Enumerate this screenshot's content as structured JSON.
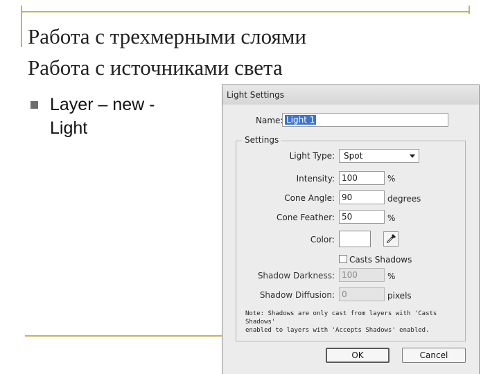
{
  "slide": {
    "title_line1": "Работа с трехмерными слоями",
    "title_line2": "Работа с источниками света",
    "bullet_line1": "Layer – new -",
    "bullet_line2": "Light"
  },
  "dialog": {
    "title": "Light Settings",
    "name_label": "Name:",
    "name_value": "Light 1",
    "settings_group": "Settings",
    "light_type_label": "Light Type:",
    "light_type_value": "Spot",
    "intensity_label": "Intensity:",
    "intensity_value": "100",
    "intensity_unit": "%",
    "cone_angle_label": "Cone Angle:",
    "cone_angle_value": "90",
    "cone_angle_unit": "degrees",
    "cone_feather_label": "Cone Feather:",
    "cone_feather_value": "50",
    "cone_feather_unit": "%",
    "color_label": "Color:",
    "color_value": "#ffffff",
    "casts_shadows_label": "Casts Shadows",
    "casts_shadows_checked": false,
    "shadow_darkness_label": "Shadow Darkness:",
    "shadow_darkness_value": "100",
    "shadow_darkness_unit": "%",
    "shadow_diffusion_label": "Shadow Diffusion:",
    "shadow_diffusion_value": "0",
    "shadow_diffusion_unit": "pixels",
    "note_line1": "Note: Shadows are only cast from layers with 'Casts Shadows'",
    "note_line2": "enabled to layers with 'Accepts Shadows' enabled.",
    "ok_label": "OK",
    "cancel_label": "Cancel"
  },
  "colors": {
    "accent_line": "#c8b35a",
    "selection": "#3a74cf",
    "dialog_bg": "#ececec"
  },
  "icons": {
    "bullet": "square-bullet-icon",
    "eyedropper": "eyedropper-icon",
    "dropdown": "chevron-down-icon"
  }
}
